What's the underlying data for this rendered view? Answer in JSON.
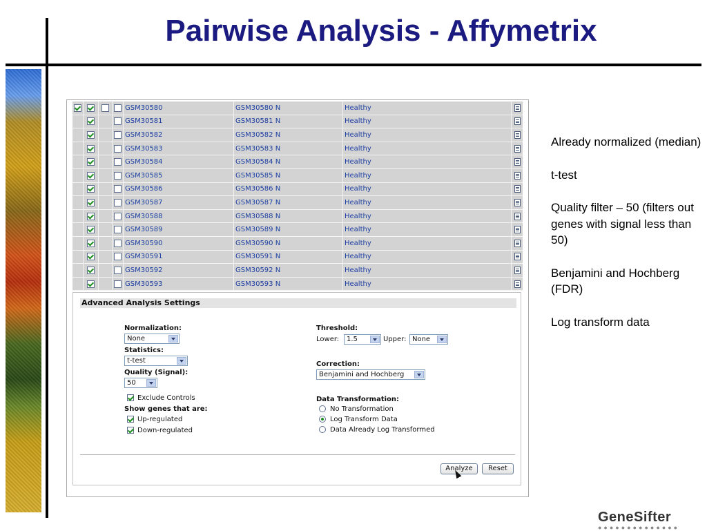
{
  "slide": {
    "title": "Pairwise Analysis - Affymetrix",
    "notes": [
      "Already normalized (median)",
      "t-test",
      "Quality filter – 50 (filters out genes with signal less than 50)",
      "Benjamini and Hochberg (FDR)",
      "Log transform data"
    ],
    "logo_text": "GeneSifter"
  },
  "samples": [
    {
      "id": "GSM30580",
      "name": "GSM30580 N",
      "group": "Healthy"
    },
    {
      "id": "GSM30581",
      "name": "GSM30581 N",
      "group": "Healthy"
    },
    {
      "id": "GSM30582",
      "name": "GSM30582 N",
      "group": "Healthy"
    },
    {
      "id": "GSM30583",
      "name": "GSM30583 N",
      "group": "Healthy"
    },
    {
      "id": "GSM30584",
      "name": "GSM30584 N",
      "group": "Healthy"
    },
    {
      "id": "GSM30585",
      "name": "GSM30585 N",
      "group": "Healthy"
    },
    {
      "id": "GSM30586",
      "name": "GSM30586 N",
      "group": "Healthy"
    },
    {
      "id": "GSM30587",
      "name": "GSM30587 N",
      "group": "Healthy"
    },
    {
      "id": "GSM30588",
      "name": "GSM30588 N",
      "group": "Healthy"
    },
    {
      "id": "GSM30589",
      "name": "GSM30589 N",
      "group": "Healthy"
    },
    {
      "id": "GSM30590",
      "name": "GSM30590 N",
      "group": "Healthy"
    },
    {
      "id": "GSM30591",
      "name": "GSM30591 N",
      "group": "Healthy"
    },
    {
      "id": "GSM30592",
      "name": "GSM30592 N",
      "group": "Healthy"
    },
    {
      "id": "GSM30593",
      "name": "GSM30593 N",
      "group": "Healthy"
    }
  ],
  "settings": {
    "header": "Advanced Analysis Settings",
    "normalization": {
      "label": "Normalization:",
      "value": "None"
    },
    "statistics": {
      "label": "Statistics:",
      "value": "t-test"
    },
    "quality": {
      "label": "Quality (Signal):",
      "value": "50"
    },
    "exclude_controls": "Exclude Controls",
    "show_genes_label": "Show genes that are:",
    "up_regulated": "Up-regulated",
    "down_regulated": "Down-regulated",
    "threshold": {
      "label": "Threshold:",
      "lower_label": "Lower:",
      "lower_value": "1.5",
      "upper_label": "Upper:",
      "upper_value": "None"
    },
    "correction": {
      "label": "Correction:",
      "value": "Benjamini and Hochberg"
    },
    "transformation": {
      "label": "Data Transformation:",
      "options": [
        "No Transformation",
        "Log Transform Data",
        "Data Already Log Transformed"
      ]
    },
    "analyze_label": "Analyze",
    "reset_label": "Reset"
  }
}
